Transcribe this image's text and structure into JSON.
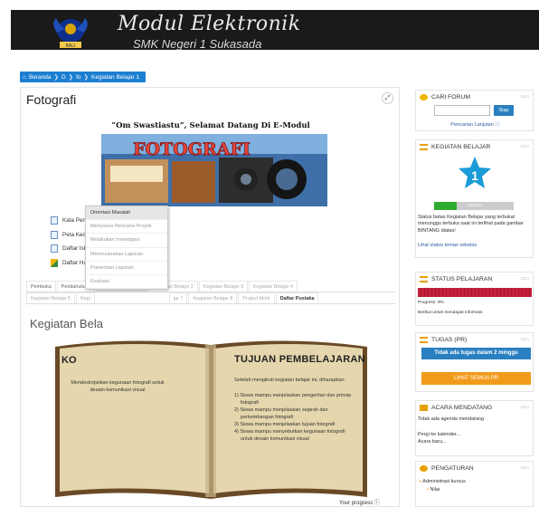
{
  "header": {
    "title": "Modul Elektronik",
    "subtitle": "SMK Negeri 1 Sukasada",
    "logo_text": "BALI"
  },
  "breadcrumb": [
    "Beranda",
    "D",
    "fo",
    "Kegiatan Belajar 1"
  ],
  "page": {
    "title": "Fotografi",
    "expand_icon": "expand-icon"
  },
  "welcome": "“Om Swastiastu”, Selamat Datang Di E-Modul",
  "banner_text": "FOTOGRAFI",
  "resources": [
    {
      "label": "Kata Pengantar",
      "icon": "page-icon"
    },
    {
      "label": "Peta Kedudukan Modul",
      "icon": "page-icon"
    },
    {
      "label": "Daftar Istilah Fotografi",
      "icon": "page-icon"
    },
    {
      "label": "Daftar Hadir Siswa",
      "icon": "zip-icon"
    }
  ],
  "tabs_row1": [
    {
      "label": "Pembuka",
      "state": "normal"
    },
    {
      "label": "Pendahuluan",
      "state": "normal"
    },
    {
      "label": "Kegiatan Belajar 1 ▾",
      "state": "active"
    },
    {
      "label": "Kegiatan Belajar 2",
      "state": "dim"
    },
    {
      "label": "Kegiatan Belajar 3",
      "state": "dim"
    },
    {
      "label": "Kegiatan Belajar 4",
      "state": "dim"
    }
  ],
  "tabs_row2": [
    {
      "label": "Kegiatan Belajar 5",
      "state": "dim"
    },
    {
      "label": "Kegi",
      "state": "dim"
    },
    {
      "label": "",
      "state": "spacer"
    },
    {
      "label": "jar 7",
      "state": "dim"
    },
    {
      "label": "Kegiatan Belajar 8",
      "state": "dim"
    },
    {
      "label": "Project Akhir",
      "state": "dim"
    },
    {
      "label": "Daftar Pustaka",
      "state": "current"
    }
  ],
  "dropdown": [
    "Orientasi Masalah",
    "Menyusun Rencana Proyek",
    "Melakukan Investigasi",
    "Merencanakan Laporan",
    "Presentasi Laporan",
    "Evaluasi"
  ],
  "section_title": "Kegiatan Bela",
  "book": {
    "left_title": "KO",
    "left_text": "Mendeskripsikan kegunaan fotografi untuk desain komunikasi visual",
    "right_title": "TUJUAN PEMBELAJARAN",
    "right_intro": "Setelah mengikuti kegiatan belajar ini, diharapkan:",
    "right_items": [
      "1) Siswa mampu menjelaskan pengertian dan prinsip fotografi",
      "2) Siswa mampu menjelaskan sejarah dan perkembangan fotografi",
      "3) Siswa mampu menjelaskan tujuan fotografi",
      "4) Siswa mampu menyebutkan kegunaan fotografi untuk desain komunikasi visual"
    ]
  },
  "your_progress": "Your progress ⓘ",
  "sidebar": {
    "forum": {
      "title": "CARI FORUM",
      "button": "Siap",
      "link": "Pencarian Lanjutan ⓘ",
      "placeholder": ""
    },
    "activities": {
      "title": "KEGIATAN BELAJAR",
      "star_number": "1",
      "bar_label": "Selesai",
      "text": "Status batas Kegiatan Belajar yang terbuka/ menunggu terbuka saat ini terlihat pada gambar BINTANG diatas!",
      "link": "Lihat status teman sekelas"
    },
    "status": {
      "title": "STATUS PELAJARAN",
      "progress_label": "Progress: 9%",
      "progress_value": 0.09,
      "hint": "Berikut untuk mendapat informasi"
    },
    "tasks": {
      "title": "TUGAS (PR)",
      "notice": "Tidak ada tugas dalam 2 minggu",
      "button": "LIHAT SEMUA PR"
    },
    "events": {
      "title": "ACARA MENDATANG",
      "text": "Tidak ada agenda mendatang",
      "link1": "Pergi ke kalender...",
      "link2": "Acara baru..."
    },
    "settings": {
      "title": "PENGATURAN",
      "item1": "Administrasi kursus",
      "item2": "Nilai"
    }
  },
  "colors": {
    "accent": "#1d7fd1",
    "header_bg": "#1a1a1a",
    "orange": "#e8a000",
    "status_red": "#c4213b",
    "task_blue": "#2a7fc0",
    "task_orange": "#f29a1c",
    "star": "#1a9bd7"
  }
}
